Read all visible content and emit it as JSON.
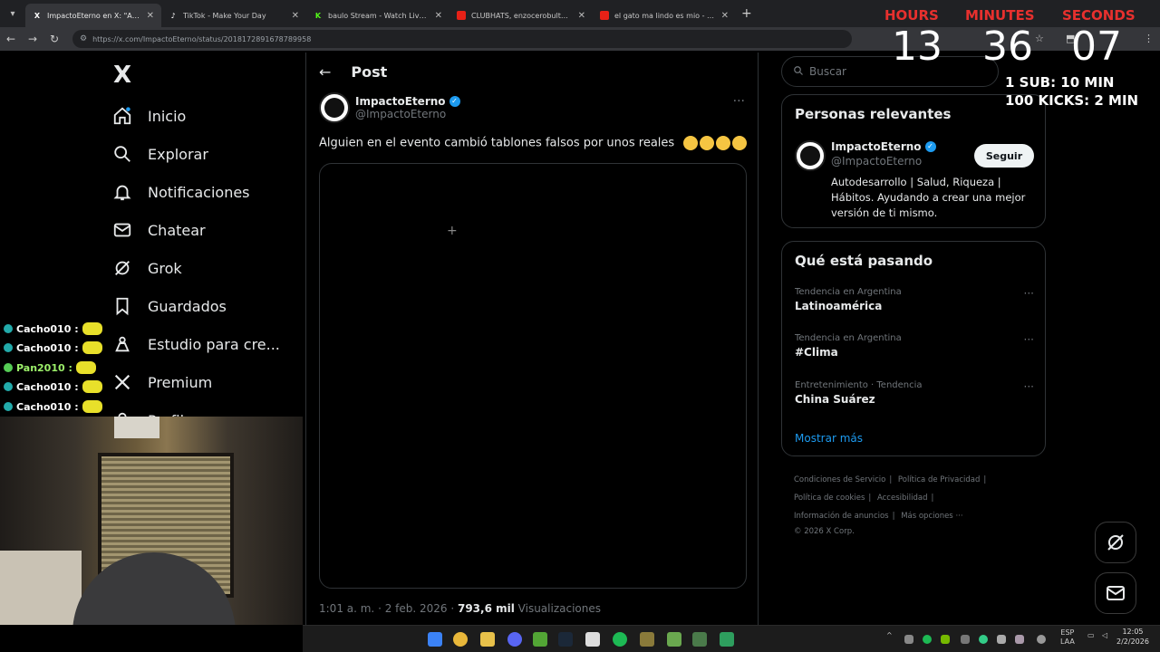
{
  "browser": {
    "tabs": [
      {
        "label": "ImpactoEterno en X: \"Alguien e",
        "icon": "x-icon",
        "active": true
      },
      {
        "label": "TikTok - Make Your Day",
        "icon": "tiktok-icon",
        "active": false
      },
      {
        "label": "baulo Stream - Watch Live on K",
        "icon": "kick-icon",
        "active": false
      },
      {
        "label": "CLUBHATS, enzocerobulto & Cl",
        "icon": "youtube-icon",
        "active": false
      },
      {
        "label": "el gato ma lindo es mio - YouTu",
        "icon": "youtube-icon",
        "active": false
      }
    ],
    "new_tab": "+",
    "url": "https://x.com/ImpactoEterno/status/2018172891678789958"
  },
  "nav": {
    "logo": "X",
    "items": [
      {
        "label": "Inicio",
        "icon": "home-icon"
      },
      {
        "label": "Explorar",
        "icon": "search-icon"
      },
      {
        "label": "Notificaciones",
        "icon": "bell-icon"
      },
      {
        "label": "Chatear",
        "icon": "mail-icon"
      },
      {
        "label": "Grok",
        "icon": "grok-icon"
      },
      {
        "label": "Guardados",
        "icon": "bookmark-icon"
      },
      {
        "label": "Estudio para cre...",
        "icon": "studio-icon"
      },
      {
        "label": "Premium",
        "icon": "x-icon"
      },
      {
        "label": "Perfil",
        "icon": "profile-icon"
      }
    ]
  },
  "post": {
    "header_title": "Post",
    "author_name": "ImpactoEterno",
    "author_handle": "@ImpactoEterno",
    "text": "Alguien en el evento cambió tablones falsos por unos reales",
    "timestamp": "1:01 a. m. · 2 feb. 2026 · ",
    "views_count": "793,6 mil",
    "views_label": " Visualizaciones"
  },
  "sidebar": {
    "search_placeholder": "Buscar",
    "relevant": {
      "title": "Personas relevantes",
      "name": "ImpactoEterno",
      "handle": "@ImpactoEterno",
      "follow_label": "Seguir",
      "bio": "Autodesarrollo | Salud, Riqueza | Hábitos. Ayudando a crear una mejor versión de ti mismo."
    },
    "trends": {
      "title": "Qué está pasando",
      "items": [
        {
          "category": "Tendencia en Argentina",
          "name": "Latinoamérica"
        },
        {
          "category": "Tendencia en Argentina",
          "name": "#Clima"
        },
        {
          "category": "Entretenimiento · Tendencia",
          "name": "China Suárez"
        }
      ],
      "show_more": "Mostrar más"
    },
    "footer": {
      "links": [
        "Condiciones de Servicio",
        "Política de Privacidad",
        "Política de cookies",
        "Accesibilidad",
        "Información de anuncios",
        "Más opciones ···"
      ],
      "copyright": "© 2026 X Corp."
    }
  },
  "overlay": {
    "timer": {
      "hours_label": "HOURS",
      "minutes_label": "MINUTES",
      "seconds_label": "SECONDS",
      "hours": "13",
      "minutes": "36",
      "seconds": "07"
    },
    "rules": [
      "1 SUB: 10 MIN",
      "100 KICKS: 2 MIN"
    ],
    "chat": [
      {
        "user": "Cacho010 :"
      },
      {
        "user": "Cacho010 :"
      },
      {
        "user": "Pan2010 :"
      },
      {
        "user": "Cacho010 :"
      },
      {
        "user": "Cacho010 :"
      }
    ]
  },
  "taskbar": {
    "lang": "ESP",
    "lang2": "LAA",
    "time": "12:05",
    "date": "2/2/2026"
  },
  "colors": {
    "accent": "#1d9bf0",
    "timer_label": "#e8302e"
  }
}
